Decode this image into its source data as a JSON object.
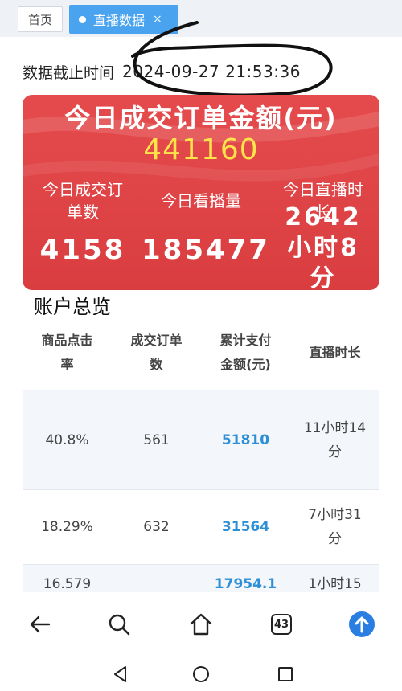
{
  "tabs": {
    "home_label": "首页",
    "live_label": "直播数据",
    "close_symbol": "×"
  },
  "cutoff": {
    "label": "数据截止时间",
    "time": "2024-09-27 21:53:36"
  },
  "summary_card": {
    "title": "今日成交订单金额(元)",
    "amount": "441160",
    "stats": [
      {
        "label_line1": "今日成交订",
        "label_line2": "单数",
        "value": "4158"
      },
      {
        "label_line1": "今日看播量",
        "label_line2": "",
        "value": "185477"
      },
      {
        "label_line1": "今日直播时",
        "label_line2": "长",
        "value_line1": "2642",
        "value_line2": "小时8",
        "value_line3": "分"
      }
    ],
    "colors": {
      "background": "#e04547",
      "amount": "#ffe34a"
    }
  },
  "account_overview": {
    "title": "账户总览",
    "columns": [
      {
        "line1": "商品点击",
        "line2": "率"
      },
      {
        "line1": "成交订单",
        "line2": "数"
      },
      {
        "line1": "累计支付",
        "line2": "金额(元)"
      },
      {
        "line1": "直播时长",
        "line2": ""
      }
    ],
    "rows": [
      {
        "click_rate": "40.8%",
        "orders": "561",
        "amount": "51810",
        "duration_line1": "11小时14",
        "duration_line2": "分"
      },
      {
        "click_rate": "18.29%",
        "orders": "632",
        "amount": "31564",
        "duration_line1": "7小时31",
        "duration_line2": "分"
      },
      {
        "click_rate": "16.579",
        "orders": "",
        "amount": "17954.1",
        "duration_line1": "1小时15",
        "duration_line2": ""
      }
    ],
    "colors": {
      "amount": "#2d8fd5",
      "row_alt": "#f3f6fb"
    }
  },
  "browser_nav": {
    "tab_count": "43",
    "icons": [
      "back-arrow-icon",
      "search-icon",
      "home-icon",
      "tabs-icon",
      "upload-icon"
    ]
  },
  "system_nav": {
    "icons": [
      "triangle-back-icon",
      "circle-home-icon",
      "square-recents-icon"
    ]
  }
}
